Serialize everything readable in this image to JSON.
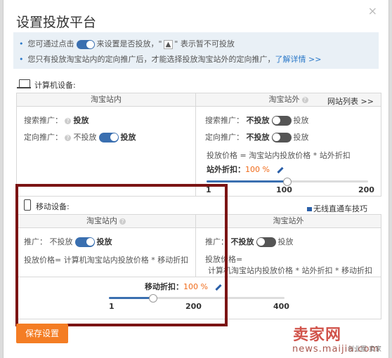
{
  "dialog": {
    "title": "设置投放平台",
    "close_glyph": "×"
  },
  "notice": {
    "line1_prefix": "您可通过点击",
    "line1_middle": "来设置是否投放，\"",
    "line1_warn": "▲",
    "line1_suffix": "\" 表示暂不可投放",
    "line2_text": "您只有投放淘宝站内的定向推广后，才能选择投放淘宝站外的定向推广，",
    "line2_link": "了解详情 >>"
  },
  "pc": {
    "header": "计算机设备:",
    "inside": {
      "title": "淘宝站内",
      "search_label": "搜索推广：",
      "search_value": "投放",
      "target_label": "定向推广：",
      "target_off": "不投放",
      "target_on": "投放"
    },
    "outside": {
      "title": "淘宝站外",
      "site_list_link": "网站列表 >>",
      "search_label": "搜索推广：",
      "search_off": "不投放",
      "search_on": "投放",
      "target_label": "定向推广：",
      "target_off": "不投放",
      "target_on": "投放",
      "formula": "投放价格 = 淘宝站内投放价格 * 站外折扣",
      "discount_label": "站外折扣：",
      "discount_value": "100 %",
      "slider": {
        "min": "1",
        "mid": "100",
        "max": "200",
        "value": 100,
        "min_value": 1,
        "max_value": 200
      }
    }
  },
  "mobile": {
    "header": "移动设备:",
    "video_link": "无线直通车技巧",
    "inside": {
      "title": "淘宝站内",
      "push_label": "推广：",
      "push_off": "不投放",
      "push_on": "投放",
      "formula": "投放价格= 计算机淘宝站内投放价格 * 移动折扣"
    },
    "outside": {
      "title": "淘宝站外",
      "push_label": "推广：",
      "push_off": "不投放",
      "push_on": "投放",
      "formula_line1": "投放价格=",
      "formula_line2": "计算机淘宝站内投放价格 * 站外折扣 * 移动折扣"
    },
    "discount_label": "移动折扣：",
    "discount_value": "100 %",
    "slider": {
      "min": "1",
      "mid": "200",
      "max": "400",
      "value": 100,
      "min_value": 1,
      "max_value": 400
    }
  },
  "save_button": "保存设置",
  "watermark": {
    "brand": "卖家网",
    "url": "news.maijia.com",
    "small": "创业圈 卖家"
  },
  "colors": {
    "accent": "#f06b1a",
    "toggle_on": "#3a6fb0",
    "highlight_border": "#7b1414",
    "save_button": "#f47d24"
  }
}
